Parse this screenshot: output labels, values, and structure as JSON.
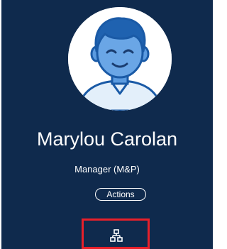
{
  "profile": {
    "name": "Marylou Carolan",
    "role": "Manager (M&P)",
    "avatar_icon": "person-avatar-icon"
  },
  "actions": {
    "actions_label": "Actions",
    "org_chart_icon": "org-chart-icon"
  },
  "colors": {
    "background": "#0f2a4d",
    "avatar_fill": "#1f62b0",
    "avatar_light": "#e3effa",
    "highlight_border": "#e8202a"
  }
}
